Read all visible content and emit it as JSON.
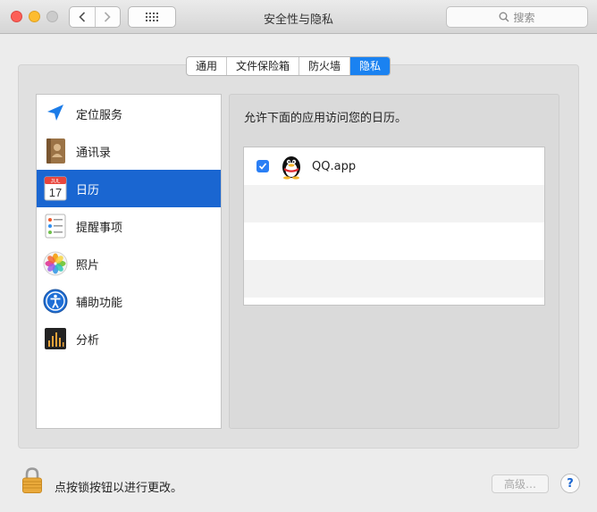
{
  "window": {
    "title": "安全性与隐私"
  },
  "toolbar": {
    "search_placeholder": "搜索"
  },
  "tabs": [
    {
      "label": "通用",
      "active": false
    },
    {
      "label": "文件保险箱",
      "active": false
    },
    {
      "label": "防火墙",
      "active": false
    },
    {
      "label": "隐私",
      "active": true
    }
  ],
  "sidebar": {
    "items": [
      {
        "label": "定位服务",
        "icon": "location-arrow-icon",
        "selected": false
      },
      {
        "label": "通讯录",
        "icon": "contacts-book-icon",
        "selected": false
      },
      {
        "label": "日历",
        "icon": "calendar-icon",
        "selected": true
      },
      {
        "label": "提醒事项",
        "icon": "reminders-icon",
        "selected": false
      },
      {
        "label": "照片",
        "icon": "photos-icon",
        "selected": false
      },
      {
        "label": "辅助功能",
        "icon": "accessibility-icon",
        "selected": false
      },
      {
        "label": "分析",
        "icon": "analytics-icon",
        "selected": false
      }
    ],
    "calendar_icon_month": "JUL",
    "calendar_icon_day": "17"
  },
  "panel": {
    "description": "允许下面的应用访问您的日历。",
    "apps": [
      {
        "name": "QQ.app",
        "checked": true,
        "icon": "qq-penguin-icon"
      }
    ]
  },
  "footer": {
    "lock_text": "点按锁按钮以进行更改。",
    "advanced_label": "高级…",
    "help_label": "?"
  },
  "colors": {
    "accent": "#1a66d1",
    "tab_active": "#1a82f1",
    "checkbox": "#2a7ff5"
  }
}
